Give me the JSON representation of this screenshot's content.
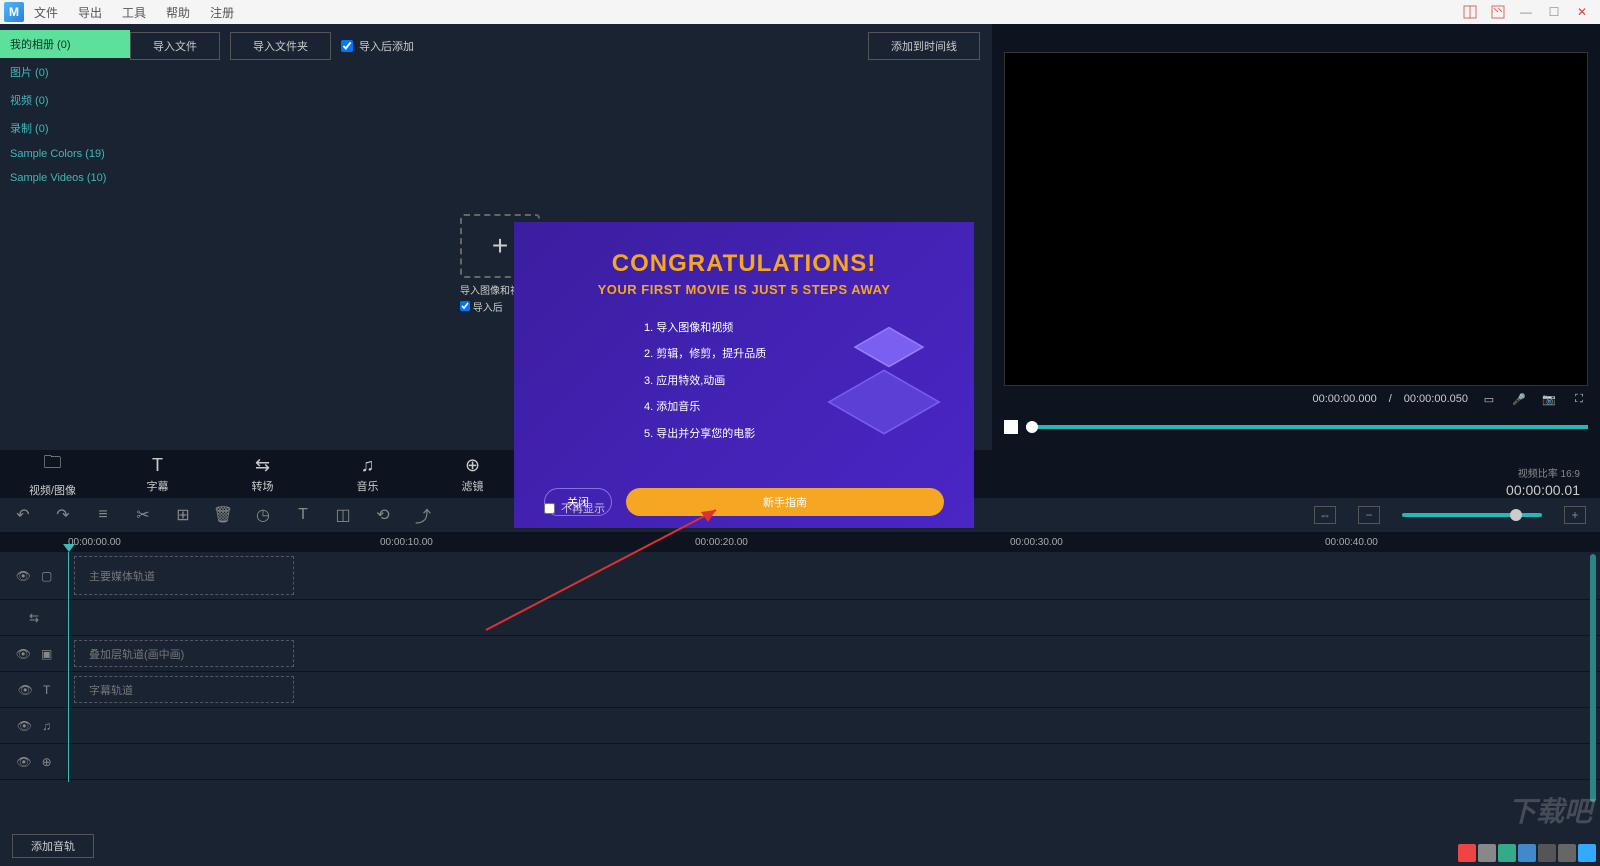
{
  "menubar": {
    "items": [
      "文件",
      "导出",
      "工具",
      "帮助",
      "注册"
    ]
  },
  "window_controls": {
    "layout1": "▢",
    "layout2": "▢",
    "minimize": "—",
    "maximize": "☐",
    "close": "✕"
  },
  "sidebar": {
    "items": [
      {
        "label": "我的相册 (0)",
        "active": true
      },
      {
        "label": "图片 (0)",
        "active": false
      },
      {
        "label": "视频 (0)",
        "active": false
      },
      {
        "label": "录制 (0)",
        "active": false
      },
      {
        "label": "Sample Colors (19)",
        "active": false
      },
      {
        "label": "Sample Videos (10)",
        "active": false
      }
    ]
  },
  "media_toolbar": {
    "import_file": "导入文件",
    "import_folder": "导入文件夹",
    "checkbox_label": "导入后添加",
    "checkbox_checked": true,
    "add_to_timeline": "添加到时间线"
  },
  "import_placeholder": {
    "label": "导入图像和视频",
    "sub_checkbox": "导入后"
  },
  "preview": {
    "time_current": "00:00:00.000",
    "time_total": "00:00:00.050"
  },
  "tabs": [
    {
      "icon": "folder-icon",
      "label": "视频/图像"
    },
    {
      "icon": "text-icon",
      "label": "字幕"
    },
    {
      "icon": "transition-icon",
      "label": "转场"
    },
    {
      "icon": "music-icon",
      "label": "音乐"
    },
    {
      "icon": "filter-icon",
      "label": "滤镜"
    }
  ],
  "tabs_right": {
    "ratio_label": "视频比率 16:9",
    "timer": "00:00:00.01"
  },
  "ruler_marks": [
    "00:00:00.00",
    "00:00:10.00",
    "00:00:20.00",
    "00:00:30.00",
    "00:00:40.00"
  ],
  "tracks": [
    {
      "label": "主要媒体轨道"
    },
    {
      "label": "叠加层轨道(画中画)"
    },
    {
      "label": "字幕轨道"
    }
  ],
  "bottom_button": "添加音轨",
  "modal": {
    "title": "CONGRATULATIONS!",
    "subtitle": "YOUR FIRST MOVIE IS JUST 5 STEPS AWAY",
    "steps": [
      "1. 导入图像和视频",
      "2. 剪辑，修剪，提升品质",
      "3. 应用特效,动画",
      "4. 添加音乐",
      "5. 导出并分享您的电影"
    ],
    "close": "关闭",
    "guide": "新手指南",
    "no_show": "不再显示"
  },
  "watermark": "下载吧"
}
